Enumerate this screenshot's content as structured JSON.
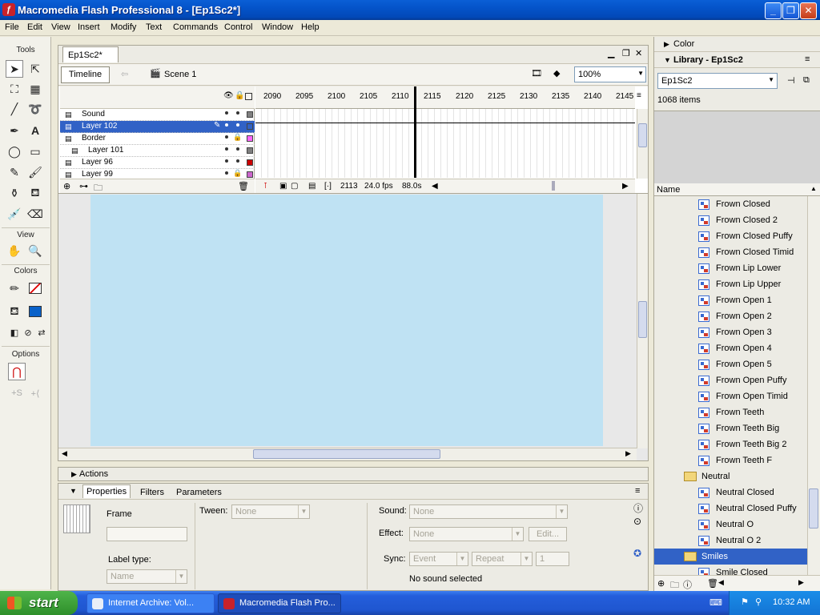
{
  "window": {
    "title": "Macromedia Flash Professional 8 - [Ep1Sc2*]"
  },
  "menu": [
    "File",
    "Edit",
    "View",
    "Insert",
    "Modify",
    "Text",
    "Commands",
    "Control",
    "Window",
    "Help"
  ],
  "tools": {
    "header": "Tools",
    "view_header": "View",
    "colors_header": "Colors",
    "options_header": "Options"
  },
  "document": {
    "tab": "Ep1Sc2*",
    "timeline_button": "Timeline",
    "scene": "Scene 1",
    "zoom": "100%"
  },
  "timeline": {
    "layers": [
      {
        "name": "Sound",
        "swatch": "#808080",
        "locked": false
      },
      {
        "name": "Layer 102",
        "swatch": "#3162c6",
        "locked": false,
        "selected": true
      },
      {
        "name": "Border",
        "swatch": "#ff66ff",
        "locked": true
      },
      {
        "name": "Layer 101",
        "swatch": "#808080",
        "locked": false
      },
      {
        "name": "Layer 96",
        "swatch": "#cc0000",
        "locked": false
      },
      {
        "name": "Layer 99",
        "swatch": "#cc66cc",
        "locked": true
      }
    ],
    "frame_numbers": [
      "2090",
      "2095",
      "2100",
      "2105",
      "2110",
      "2115",
      "2120",
      "2125",
      "2130",
      "2135",
      "2140",
      "2145"
    ],
    "current_frame": "2113",
    "fps": "24.0 fps",
    "elapsed": "88.0s"
  },
  "stage": {
    "color": "#bfe2f3"
  },
  "actions": {
    "label": "Actions"
  },
  "properties": {
    "tabs": [
      "Properties",
      "Filters",
      "Parameters"
    ],
    "frame_label": "Frame",
    "label_type_label": "Label type:",
    "label_type_value": "Name",
    "tween_label": "Tween:",
    "tween_value": "None",
    "sound_label": "Sound:",
    "sound_value": "None",
    "effect_label": "Effect:",
    "effect_value": "None",
    "edit_button": "Edit...",
    "sync_label": "Sync:",
    "sync_value": "Event",
    "repeat_value": "Repeat",
    "repeat_count": "1",
    "no_sound": "No sound selected"
  },
  "panels": {
    "color": "Color",
    "library": "Library - Ep1Sc2",
    "library_select": "Ep1Sc2",
    "item_count": "1068 items",
    "name_column": "Name",
    "items": [
      {
        "name": "Frown Closed",
        "kind": "symbol"
      },
      {
        "name": "Frown Closed 2",
        "kind": "symbol"
      },
      {
        "name": "Frown Closed Puffy",
        "kind": "symbol"
      },
      {
        "name": "Frown Closed Timid",
        "kind": "symbol"
      },
      {
        "name": "Frown Lip Lower",
        "kind": "symbol"
      },
      {
        "name": "Frown Lip Upper",
        "kind": "symbol"
      },
      {
        "name": "Frown Open 1",
        "kind": "symbol"
      },
      {
        "name": "Frown Open 2",
        "kind": "symbol"
      },
      {
        "name": "Frown Open 3",
        "kind": "symbol"
      },
      {
        "name": "Frown Open 4",
        "kind": "symbol"
      },
      {
        "name": "Frown Open 5",
        "kind": "symbol"
      },
      {
        "name": "Frown Open Puffy",
        "kind": "symbol"
      },
      {
        "name": "Frown Open Timid",
        "kind": "symbol"
      },
      {
        "name": "Frown Teeth",
        "kind": "symbol"
      },
      {
        "name": "Frown Teeth Big",
        "kind": "symbol"
      },
      {
        "name": "Frown Teeth Big 2",
        "kind": "symbol"
      },
      {
        "name": "Frown Teeth F",
        "kind": "symbol"
      },
      {
        "name": "Neutral",
        "kind": "folder-open"
      },
      {
        "name": "Neutral Closed",
        "kind": "symbol"
      },
      {
        "name": "Neutral Closed Puffy",
        "kind": "symbol"
      },
      {
        "name": "Neutral O",
        "kind": "symbol"
      },
      {
        "name": "Neutral O 2",
        "kind": "symbol"
      },
      {
        "name": "Smiles",
        "kind": "folder",
        "selected": true
      },
      {
        "name": "Smile Closed",
        "kind": "symbol"
      }
    ]
  },
  "taskbar": {
    "start": "start",
    "items": [
      "Internet Archive: Vol...",
      "Macromedia Flash Pro..."
    ],
    "clock": "10:32 AM"
  }
}
